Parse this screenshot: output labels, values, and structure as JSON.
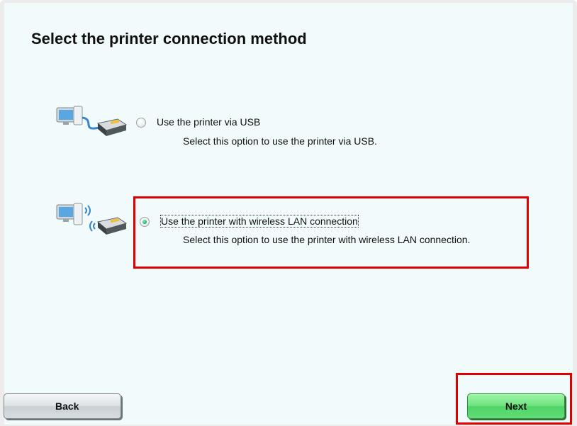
{
  "dialog": {
    "title": "Select the printer connection method"
  },
  "options": [
    {
      "label": "Use the printer via USB",
      "description": "Select this option to use the printer via USB.",
      "icon": "usb-connection-icon",
      "selected": false
    },
    {
      "label": "Use the printer with wireless LAN connection",
      "description": "Select this option to use the printer with wireless LAN connection.",
      "icon": "wireless-lan-connection-icon",
      "selected": true
    }
  ],
  "buttons": {
    "back_label": "Back",
    "next_label": "Next"
  },
  "colors": {
    "background": "#f2fbfb",
    "highlight": "#e00000",
    "next_button": "#5fdc74"
  }
}
